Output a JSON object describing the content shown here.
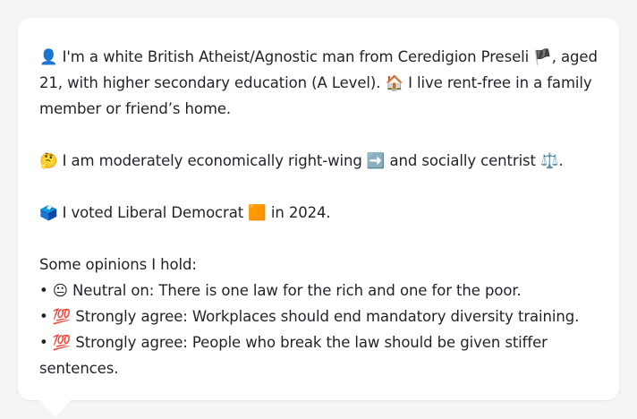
{
  "profile": {
    "intro": {
      "person_emoji": "👤",
      "text_a": " I'm a white British Atheist/Agnostic man from Ceredigion Preseli ",
      "flag_emoji": "🏴",
      "text_b": ", aged 21, with higher secondary education (A Level). ",
      "house_emoji": "🏠",
      "text_c": " I live rent-free in a family member or friend’s home."
    },
    "stance": {
      "thinking_emoji": "🤔",
      "text_a": " I am moderately economically right-wing ",
      "arrow_emoji": "➡️",
      "text_b": " and socially centrist ",
      "scales_emoji": "⚖️",
      "text_c": "."
    },
    "vote": {
      "ballot_emoji": "🗳️",
      "text_a": " I voted Liberal Democrat ",
      "square_emoji": "🟧",
      "text_b": " in 2024."
    },
    "opinions": {
      "heading": "Some opinions I hold:",
      "items": [
        {
          "bullet": "•",
          "emoji": "😐",
          "text": " Neutral on: There is one law for the rich and one for the poor."
        },
        {
          "bullet": "•",
          "emoji": "💯",
          "text": " Strongly agree: Workplaces should end mandatory diversity training."
        },
        {
          "bullet": "•",
          "emoji": "💯",
          "text": " Strongly agree: People who break the law should be given stiffer sentences."
        }
      ]
    }
  },
  "colors": {
    "background": "#f4f5f7",
    "bubble": "#ffffff",
    "text": "#1f2328"
  }
}
